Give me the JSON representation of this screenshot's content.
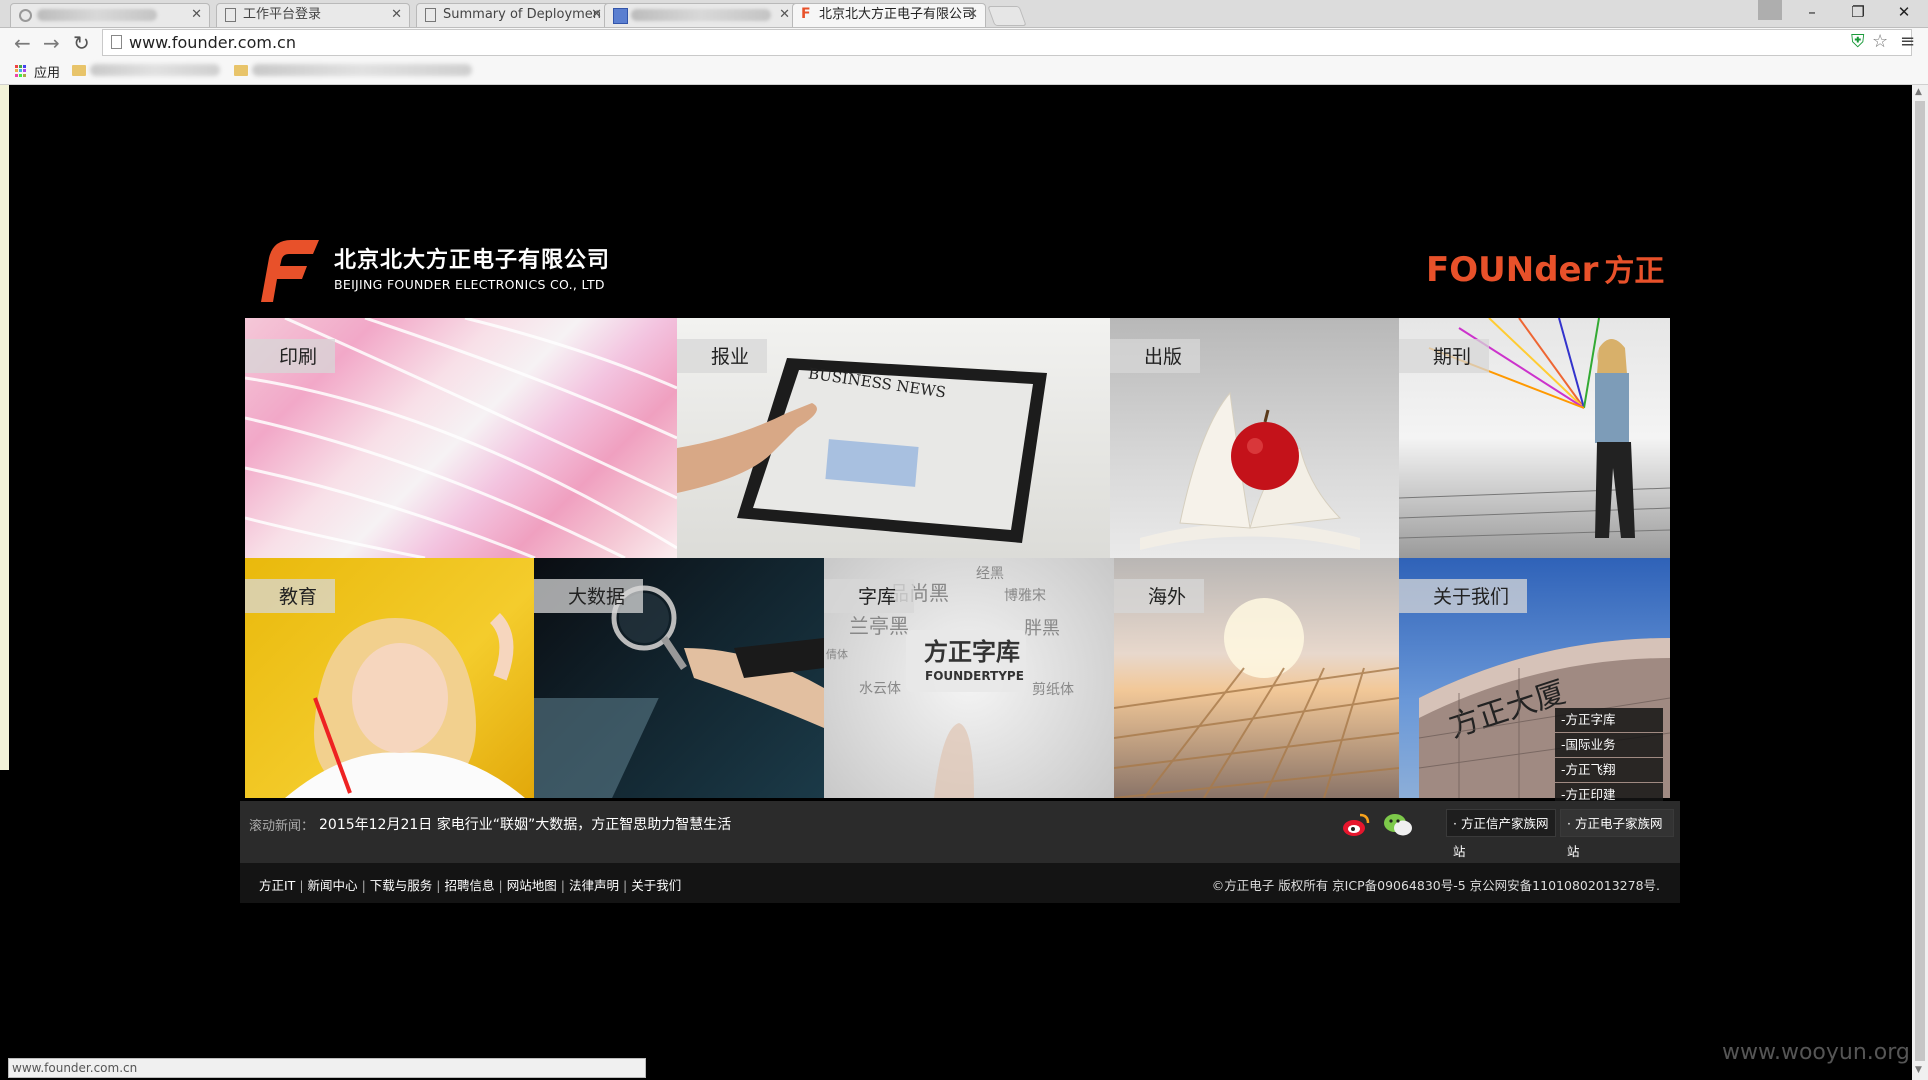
{
  "browser": {
    "tabs": [
      {
        "title": "",
        "blurred": true
      },
      {
        "title": "工作平台登录"
      },
      {
        "title": "Summary of Deploymen"
      },
      {
        "title": "",
        "blurred": true
      },
      {
        "title": "北京北大方正电子有限公司"
      }
    ],
    "url": "www.founder.com.cn",
    "bookmarks_apps_label": "应用",
    "status_url": "www.founder.com.cn",
    "window_controls": {
      "minimize": "–",
      "restore": "❐",
      "close": "✕"
    }
  },
  "header": {
    "company_cn": "北京北大方正电子有限公司",
    "company_en": "BEIJING FOUNDER ELECTRONICS CO., LTD",
    "brand_en": "FOUNder",
    "brand_cn": "方正"
  },
  "tiles": [
    {
      "label": "印刷"
    },
    {
      "label": "报业",
      "art_text": "BUSINESS NEWS"
    },
    {
      "label": "出版"
    },
    {
      "label": "期刊"
    },
    {
      "label": "教育"
    },
    {
      "label": "大数据"
    },
    {
      "label": "字库",
      "art_text_main": "方正字库",
      "art_text_sub": "FOUNDERTYPE",
      "art_text_extra": [
        "品尚黑",
        "兰亭黑",
        "博雅宋",
        "经黑",
        "胖黑",
        "水云体",
        "倩体",
        "剪纸体"
      ]
    },
    {
      "label": "海外"
    },
    {
      "label": "关于我们",
      "art_text": "方正大厦"
    }
  ],
  "ticker": {
    "label": "滚动新闻：",
    "news": "2015年12月21日 家电行业“联姻”大数据，方正智思助力智慧生活"
  },
  "family_sites": {
    "xinchan": "· 方正信产家族网站",
    "dianzi": "· 方正电子家族网站",
    "dropdown": [
      "-方正字库",
      "-国际业务",
      "-方正飞翔",
      "-方正印建"
    ]
  },
  "footer": {
    "links": [
      "方正IT",
      "新闻中心",
      "下载与服务",
      "招聘信息",
      "网站地图",
      "法律声明",
      "关于我们"
    ],
    "copyright": "©方正电子 版权所有    京ICP备09064830号-5 京公网安备11010802013278号."
  },
  "watermark": "www.wooyun.org",
  "colors": {
    "brand_orange": "#e8512a",
    "page_bg": "#000000",
    "ticker_bg": "#2b2b2b",
    "footer_bg": "#141414"
  }
}
